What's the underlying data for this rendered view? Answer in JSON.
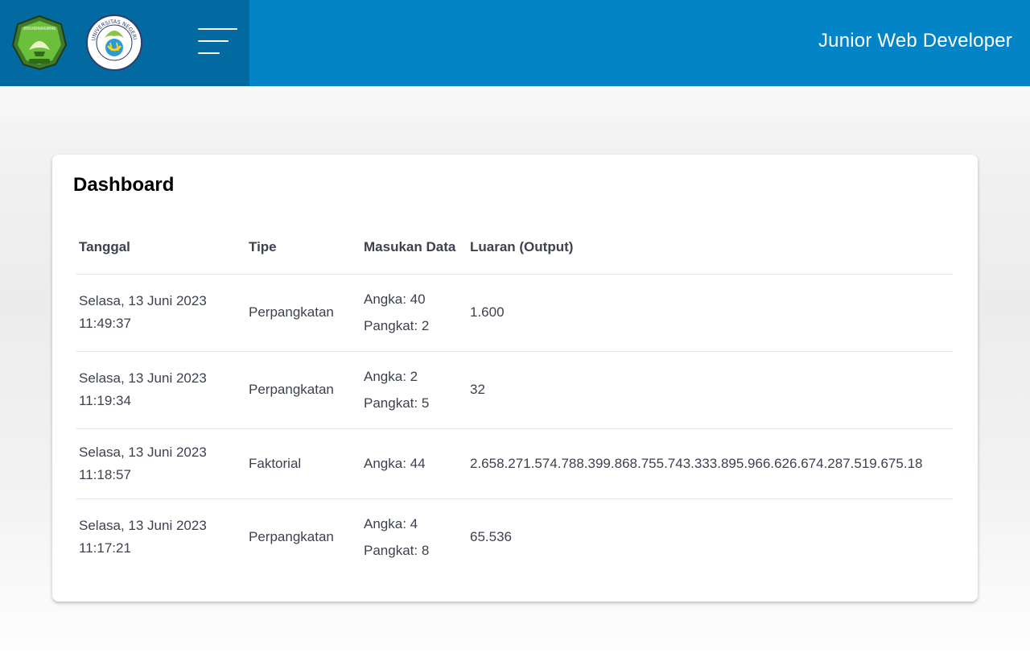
{
  "header": {
    "app_title": "Junior Web Developer",
    "colors": {
      "bar": "#0284c7",
      "brand_panel": "#0369a1"
    },
    "logos": [
      "uin-malang-logo",
      "universitas-negeri-malang-logo"
    ],
    "logo_um_text": "UNIVERSITAS NEGERI MALANG",
    "logo_uin_text": "UNIVERSITAS ISLAM NEGERI MAULANA MALIK IBRAHIM MALANG",
    "menu_icon": "hamburger-menu-icon"
  },
  "dashboard": {
    "title": "Dashboard",
    "columns": [
      "Tanggal",
      "Tipe",
      "Masukan Data",
      "Luaran (Output)"
    ],
    "rows": [
      {
        "date": "Selasa, 13 Juni 2023",
        "time": "11:49:37",
        "type": "Perpangkatan",
        "inputs": [
          "Angka: 40",
          "Pangkat: 2"
        ],
        "output": "1.600"
      },
      {
        "date": "Selasa, 13 Juni 2023",
        "time": "11:19:34",
        "type": "Perpangkatan",
        "inputs": [
          "Angka: 2",
          "Pangkat: 5"
        ],
        "output": "32"
      },
      {
        "date": "Selasa, 13 Juni 2023",
        "time": "11:18:57",
        "type": "Faktorial",
        "inputs": [
          "Angka: 44"
        ],
        "output": "2.658.271.574.788.399.868.755.743.333.895.966.626.674.287.519.675.18"
      },
      {
        "date": "Selasa, 13 Juni 2023",
        "time": "11:17:21",
        "type": "Perpangkatan",
        "inputs": [
          "Angka: 4",
          "Pangkat: 8"
        ],
        "output": "65.536"
      }
    ]
  }
}
